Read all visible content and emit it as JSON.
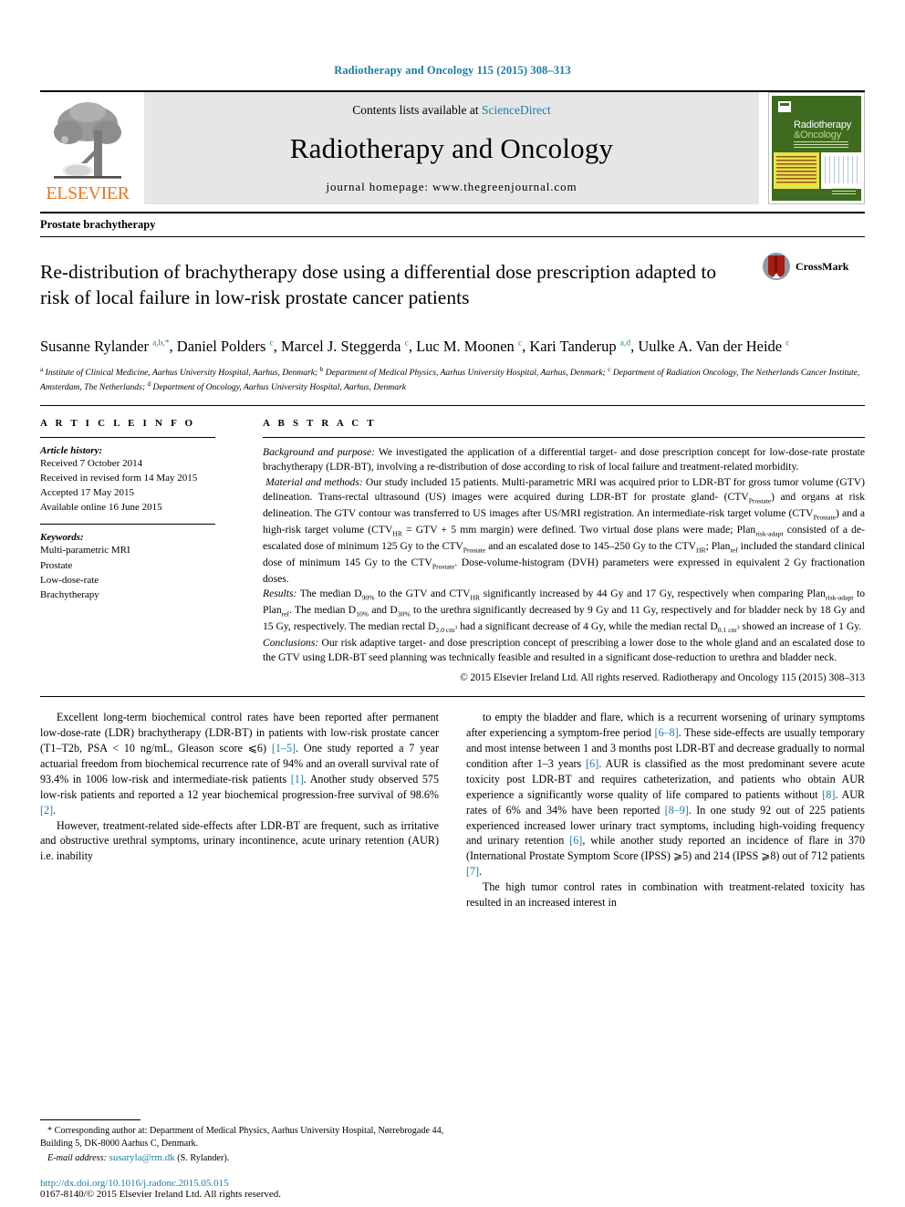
{
  "running_head": "Radiotherapy and Oncology 115 (2015) 308–313",
  "masthead": {
    "publisher": "ELSEVIER",
    "contents_prefix": "Contents lists available at ",
    "contents_link": "ScienceDirect",
    "journal_title": "Radiotherapy and Oncology",
    "homepage": "journal homepage: www.thegreenjournal.com",
    "cover": {
      "line1": "Radiotherapy",
      "line2": "&Oncology"
    }
  },
  "section_title": "Prostate brachytherapy",
  "article": {
    "title": "Re-distribution of brachytherapy dose using a differential dose prescription adapted to risk of local failure in low-risk prostate cancer patients",
    "crossmark_label": "CrossMark",
    "authors_html": "Susanne Rylander <sup>a,b,</sup><sup>*</sup>, Daniel Polders <sup>c</sup>, Marcel J. Steggerda <sup>c</sup>, Luc M. Moonen <sup>c</sup>, Kari Tanderup <sup>a,d</sup>, Uulke A. Van der Heide <sup>c</sup>",
    "affiliations_html": "<sup>a</sup> Institute of Clinical Medicine, Aarhus University Hospital, Aarhus, Denmark; <sup>b</sup> Department of Medical Physics, Aarhus University Hospital, Aarhus, Denmark; <sup>c</sup> Department of Radiation Oncology, The Netherlands Cancer Institute, Amsterdam, The Netherlands; <sup>d</sup> Department of Oncology, Aarhus University Hospital, Aarhus, Denmark"
  },
  "article_info": {
    "heading": "A R T I C L E    I N F O",
    "history_label": "Article history:",
    "history": [
      "Received 7 October 2014",
      "Received in revised form 14 May 2015",
      "Accepted 17 May 2015",
      "Available online 16 June 2015"
    ],
    "keywords_label": "Keywords:",
    "keywords": [
      "Multi-parametric MRI",
      "Prostate",
      "Low-dose-rate",
      "Brachytherapy"
    ]
  },
  "abstract": {
    "heading": "A B S T R A C T",
    "paragraphs_html": [
      "<span class=\"abs-lead\">Background and purpose:</span> We investigated the application of a differential target- and dose prescription concept for low-dose-rate prostate brachytherapy (LDR-BT), involving a re-distribution of dose according to risk of local failure and treatment-related morbidity.",
      "&nbsp;<span class=\"abs-lead\">Material and methods:</span> Our study included 15 patients. Multi-parametric MRI was acquired prior to LDR-BT for gross tumor volume (GTV) delineation. Trans-rectal ultrasound (US) images were acquired during LDR-BT for prostate gland- (CTV<sub>Prostate</sub>) and organs at risk delineation. The GTV contour was transferred to US images after US/MRI registration. An intermediate-risk target volume (CTV<sub>Prostate</sub>) and a high-risk target volume (CTV<sub>HR</sub> = GTV + 5 mm margin) were defined. Two virtual dose plans were made; Plan<sub>risk-adapt</sub> consisted of a de-escalated dose of minimum 125 Gy to the CTV<sub>Prostate</sub> and an escalated dose to 145–250 Gy to the CTV<sub>HR</sub>; Plan<sub>ref</sub> included the standard clinical dose of minimum 145 Gy to the CTV<sub>Prostate</sub>. Dose-volume-histogram (DVH) parameters were expressed in equivalent 2 Gy fractionation doses.",
      "<span class=\"abs-lead\">Results:</span> The median D<sub>90%</sub> to the GTV and CTV<sub>HR</sub> significantly increased by 44 Gy and 17 Gy, respectively when comparing Plan<sub>risk-adapt</sub> to Plan<sub>ref</sub>. The median D<sub>10%</sub> and D<sub>30%</sub> to the urethra significantly decreased by 9 Gy and 11 Gy, respectively and for bladder neck by 18 Gy and 15 Gy, respectively. The median rectal D<sub>2.0 cm<sup>3</sup></sub> had a significant decrease of 4 Gy, while the median rectal D<sub>0.1 cm<sup>3</sup></sub> showed an increase of 1 Gy.",
      "<span class=\"abs-lead\">Conclusions:</span> Our risk adaptive target- and dose prescription concept of prescribing a lower dose to the whole gland and an escalated dose to the GTV using LDR-BT seed planning was technically feasible and resulted in a significant dose-reduction to urethra and bladder neck."
    ],
    "copyright": "© 2015 Elsevier Ireland Ltd. All rights reserved. Radiotherapy and Oncology 115 (2015) 308–313"
  },
  "body": {
    "left_column_html": [
      "Excellent long-term biochemical control rates have been reported after permanent low-dose-rate (LDR) brachytherapy (LDR-BT) in patients with low-risk prostate cancer (T1–T2b, PSA &lt; 10 ng/mL, Gleason score ⩽6) <span class=\"ref\">[1–5]</span>. One study reported a 7 year actuarial freedom from biochemical recurrence rate of 94% and an overall survival rate of 93.4% in 1006 low-risk and intermediate-risk patients <span class=\"ref\">[1]</span>. Another study observed 575 low-risk patients and reported a 12 year biochemical progression-free survival of 98.6% <span class=\"ref\">[2]</span>.",
      "However, treatment-related side-effects after LDR-BT are frequent, such as irritative and obstructive urethral symptoms, urinary incontinence, acute urinary retention (AUR) i.e. inability"
    ],
    "right_column_html": [
      "to empty the bladder and flare, which is a recurrent worsening of urinary symptoms after experiencing a symptom-free period <span class=\"ref\">[6–8]</span>. These side-effects are usually temporary and most intense between 1 and 3 months post LDR-BT and decrease gradually to normal condition after 1–3 years <span class=\"ref\">[6]</span>. AUR is classified as the most predominant severe acute toxicity post LDR-BT and requires catheterization, and patients who obtain AUR experience a significantly worse quality of life compared to patients without <span class=\"ref\">[8]</span>. AUR rates of 6% and 34% have been reported <span class=\"ref\">[8–9]</span>. In one study 92 out of 225 patients experienced increased lower urinary tract symptoms, including high-voiding frequency and urinary retention <span class=\"ref\">[6]</span>, while another study reported an incidence of flare in 370 (International Prostate Symptom Score (IPSS) ⩾5) and 214 (IPSS ⩾8) out of 712 patients <span class=\"ref\">[7]</span>.",
      "The high tumor control rates in combination with treatment-related toxicity has resulted in an increased interest in"
    ]
  },
  "footnotes": {
    "corresponding_html": "* Corresponding author at: Department of Medical Physics, Aarhus University Hospital, Nørrebrogade 44, Building 5, DK-8000 Aarhus C, Denmark.",
    "email_label": "E-mail address:",
    "email": "susaryla@rm.dk",
    "email_suffix": "(S. Rylander).",
    "doi": "http://dx.doi.org/10.1016/j.radonc.2015.05.015",
    "issn": "0167-8140/© 2015 Elsevier Ireland Ltd. All rights reserved."
  },
  "colors": {
    "link": "#1a7ba8",
    "elsevier_orange": "#E87722",
    "cover_green": "#3e6b1f"
  }
}
